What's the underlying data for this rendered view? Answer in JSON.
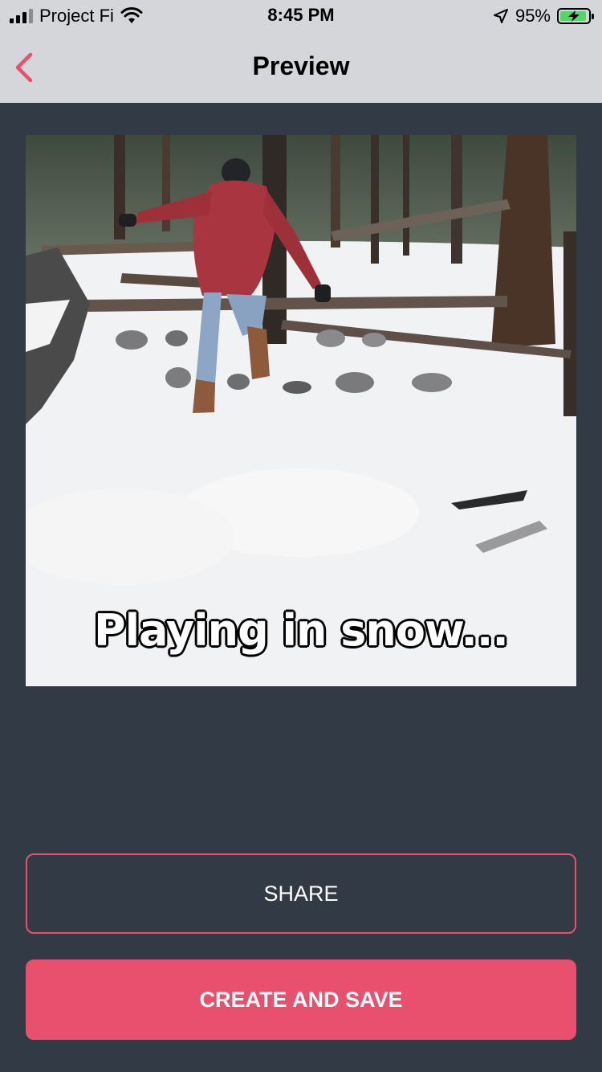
{
  "status_bar": {
    "carrier": "Project Fi",
    "time": "8:45 PM",
    "battery_percent": "95%",
    "battery_level": 0.95,
    "icons": [
      "signal-icon",
      "wifi-icon",
      "location-arrow-icon",
      "battery-charging-icon"
    ]
  },
  "nav": {
    "title": "Preview",
    "back_icon": "chevron-left-icon"
  },
  "preview": {
    "caption": "Playing in snow..."
  },
  "actions": {
    "share_label": "SHARE",
    "create_save_label": "CREATE AND SAVE"
  },
  "colors": {
    "background": "#323a45",
    "bar_background": "#d4d6d9",
    "accent": "#e8506e",
    "battery_green": "#4cd964"
  }
}
